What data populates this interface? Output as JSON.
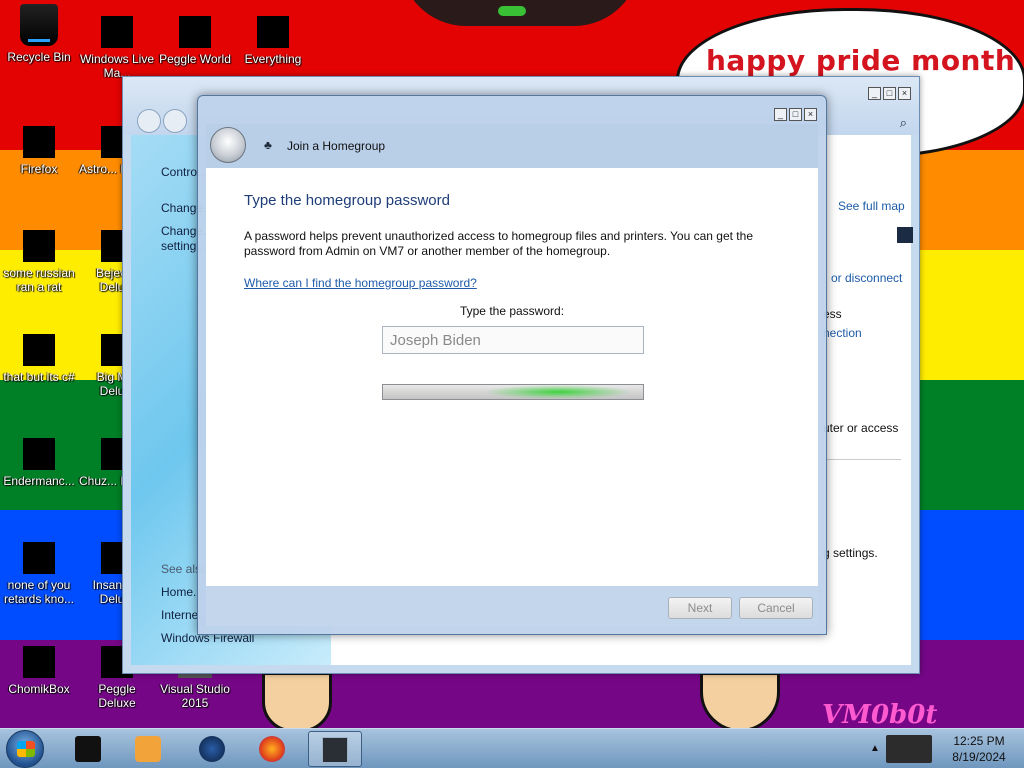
{
  "desktop": {
    "banner_text": "happy pride month",
    "watermark": "VM0b0t",
    "icons": [
      {
        "label": "Recycle Bin"
      },
      {
        "label": "Windows Live Ma..."
      },
      {
        "label": "Peggle World"
      },
      {
        "label": "Everything"
      },
      {
        "label": "Firefox"
      },
      {
        "label": "Astro... Delu..."
      },
      {
        "label": "some russian ran a rat"
      },
      {
        "label": "Bejew... Delu..."
      },
      {
        "label": "that but its c#"
      },
      {
        "label": "Big M... Delu..."
      },
      {
        "label": "Endermanc..."
      },
      {
        "label": "Chuz... Delu..."
      },
      {
        "label": "none of you retards kno..."
      },
      {
        "label": "Insaniq... Delu..."
      },
      {
        "label": "ChomikBox"
      },
      {
        "label": "Peggle Deluxe"
      },
      {
        "label": "Visual Studio 2015"
      }
    ]
  },
  "control_panel": {
    "sidebar": {
      "item1": "Contro...",
      "item2": "Change...",
      "item3": "Change...",
      "item3b": "setting...",
      "see_also": "See also",
      "link1": "Home...",
      "link2": "Interne...",
      "link3": "Windows Firewall"
    },
    "main": {
      "see_full_map": "See full map",
      "disconnect": "or disconnect",
      "access": "ess",
      "connection": "nection",
      "computer_access": "uter or access",
      "settings": "g settings."
    }
  },
  "dialog": {
    "title": "Join a Homegroup",
    "heading": "Type the homegroup password",
    "paragraph": "A password helps prevent unauthorized access to homegroup files and printers. You can get the password from Admin on VM7 or another member of the homegroup.",
    "help_link": "Where can I find the homegroup password?",
    "password_label": "Type the password:",
    "password_value": "Joseph Biden",
    "progress_state": "indeterminate",
    "next_label": "Next",
    "cancel_label": "Cancel"
  },
  "taskbar": {
    "items": [
      {
        "icon": "recycle-app-icon"
      },
      {
        "icon": "media-player-icon"
      },
      {
        "icon": "globe-icon"
      },
      {
        "icon": "firefox-icon"
      },
      {
        "icon": "control-panel-icon",
        "active": true
      }
    ],
    "clock_time": "12:25 PM",
    "clock_date": "8/19/2024"
  }
}
